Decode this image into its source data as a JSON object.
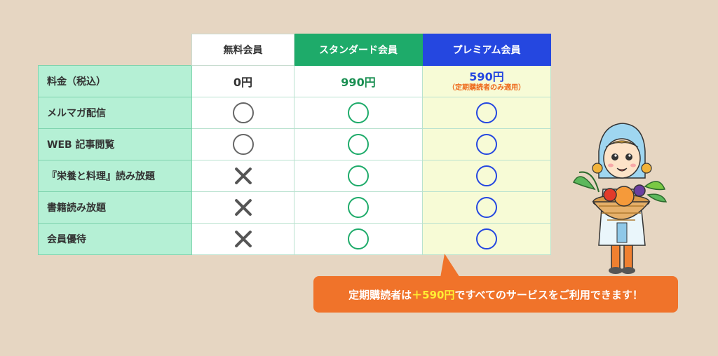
{
  "columns": {
    "free": "無料会員",
    "standard": "スタンダード会員",
    "premium": "プレミアム会員"
  },
  "rows": [
    {
      "label": "料金（税込）",
      "free": "0円",
      "standard": "990円",
      "premium": "590円",
      "premium_note": "（定期購読者のみ適用）"
    },
    {
      "label": "メルマガ配信",
      "free": "circle",
      "standard": "circle",
      "premium": "circle"
    },
    {
      "label": "WEB 記事閲覧",
      "free": "circle",
      "standard": "circle",
      "premium": "circle"
    },
    {
      "label": "『栄養と料理』読み放題",
      "free": "cross",
      "standard": "circle",
      "premium": "circle"
    },
    {
      "label": "書籍読み放題",
      "free": "cross",
      "standard": "circle",
      "premium": "circle"
    },
    {
      "label": "会員優待",
      "free": "cross",
      "standard": "circle",
      "premium": "circle"
    }
  ],
  "callout": {
    "before": "定期購読者は",
    "highlight": "＋590円",
    "after": "ですべてのサービスをご利用できます！"
  },
  "colors": {
    "standard": "#1eab6a",
    "premium": "#2547e0",
    "callout": "#f0732a",
    "highlight": "#ffee33",
    "label_bg": "#b5f0d5"
  },
  "icons": {
    "available": "circle-icon",
    "unavailable": "cross-icon",
    "character": "mascot-illustration"
  }
}
